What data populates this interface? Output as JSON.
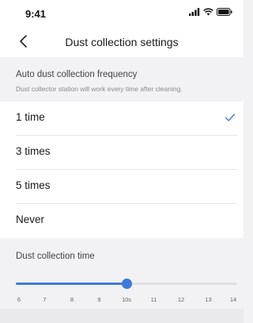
{
  "status_bar": {
    "time": "9:41"
  },
  "nav": {
    "title": "Dust collection settings"
  },
  "frequency": {
    "title": "Auto dust collection frequency",
    "subtitle": "Dust collector station will work every time after cleaning.",
    "options": [
      {
        "label": "1 time",
        "selected": true
      },
      {
        "label": "3 times",
        "selected": false
      },
      {
        "label": "5 times",
        "selected": false
      },
      {
        "label": "Never",
        "selected": false
      }
    ]
  },
  "collection_time": {
    "title": "Dust collection time",
    "ticks": [
      "6",
      "7",
      "8",
      "9",
      "10s",
      "11",
      "12",
      "13",
      "14"
    ],
    "min": 6,
    "max": 14,
    "value": 10
  },
  "colors": {
    "accent": "#3e7bd6",
    "track": "#dfe0e3"
  }
}
